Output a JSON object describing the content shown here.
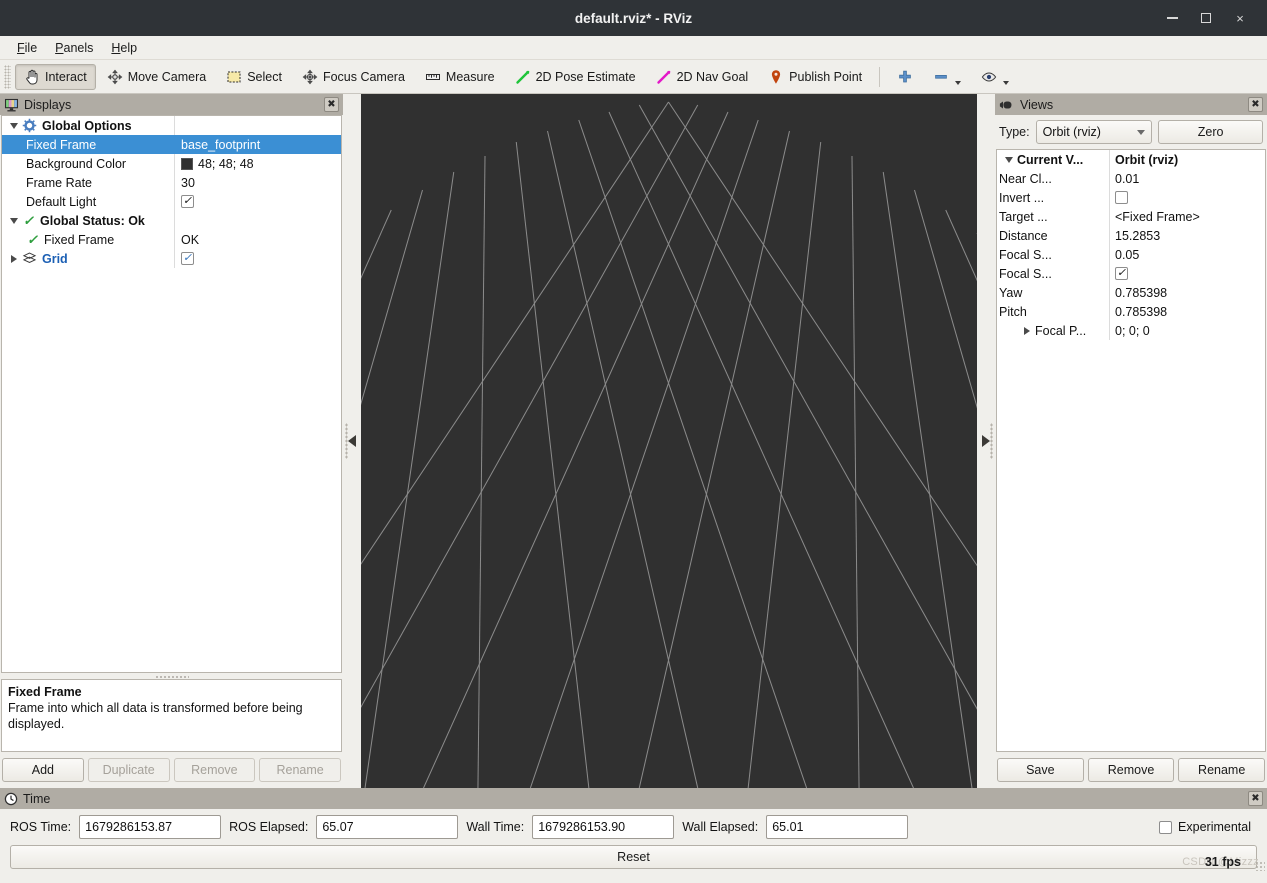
{
  "window": {
    "title": "default.rviz* - RViz",
    "controls": {
      "minimize": "minimize-icon",
      "maximize": "maximize-icon",
      "close": "×"
    }
  },
  "menubar": {
    "items": [
      "File",
      "Panels",
      "Help"
    ]
  },
  "toolbar": {
    "items": [
      {
        "label": "Interact",
        "icon": "hand-cursor-icon",
        "checked": true
      },
      {
        "label": "Move Camera",
        "icon": "move-camera-icon",
        "checked": false
      },
      {
        "label": "Select",
        "icon": "select-rect-icon",
        "checked": false
      },
      {
        "label": "Focus Camera",
        "icon": "focus-camera-icon",
        "checked": false
      },
      {
        "label": "Measure",
        "icon": "ruler-icon",
        "checked": false
      },
      {
        "label": "2D Pose Estimate",
        "icon": "pose-estimate-arrow-icon",
        "checked": false
      },
      {
        "label": "2D Nav Goal",
        "icon": "nav-goal-arrow-icon",
        "checked": false
      },
      {
        "label": "Publish Point",
        "icon": "map-pin-icon",
        "checked": false
      }
    ],
    "extras": [
      {
        "name": "zoom-in-icon",
        "glyph": "+"
      },
      {
        "name": "zoom-out-icon",
        "glyph": "−"
      },
      {
        "name": "eye-icon",
        "glyph": "eye"
      }
    ]
  },
  "displays": {
    "title": "Displays",
    "title_icon": "monitor-icon",
    "close_glyph": "✖",
    "rows": [
      {
        "name": "Global Options",
        "value": "",
        "indent": 0,
        "expander": "down",
        "icon": "gear-icon",
        "bold": true,
        "selected": false,
        "value_type": "none"
      },
      {
        "name": "Fixed Frame",
        "value": "base_footprint",
        "indent": 1,
        "expander": "none",
        "icon": "none",
        "bold": false,
        "selected": true,
        "value_type": "text"
      },
      {
        "name": "Background Color",
        "value": "48; 48; 48",
        "indent": 1,
        "expander": "none",
        "icon": "none",
        "bold": false,
        "selected": false,
        "value_type": "color",
        "swatch": "#303030"
      },
      {
        "name": "Frame Rate",
        "value": "30",
        "indent": 1,
        "expander": "none",
        "icon": "none",
        "bold": false,
        "selected": false,
        "value_type": "text"
      },
      {
        "name": "Default Light",
        "value": "checked",
        "indent": 1,
        "expander": "none",
        "icon": "none",
        "bold": false,
        "selected": false,
        "value_type": "checkbox"
      },
      {
        "name": "Global Status: Ok",
        "value": "",
        "indent": 0,
        "expander": "down",
        "icon": "green-check",
        "bold": true,
        "selected": false,
        "value_type": "none"
      },
      {
        "name": "Fixed Frame",
        "value": "OK",
        "indent": 1,
        "expander": "none",
        "icon": "green-check",
        "bold": false,
        "selected": false,
        "value_type": "text"
      },
      {
        "name": "Grid",
        "value": "checked",
        "indent": 0,
        "expander": "right",
        "icon": "grid-icon",
        "bold": true,
        "selected": false,
        "value_type": "checkbox",
        "blue": true
      }
    ],
    "help": {
      "heading": "Fixed Frame",
      "body": "Frame into which all data is transformed before being displayed."
    },
    "buttons": [
      {
        "label": "Add",
        "disabled": false
      },
      {
        "label": "Duplicate",
        "disabled": true
      },
      {
        "label": "Remove",
        "disabled": true
      },
      {
        "label": "Rename",
        "disabled": true
      }
    ]
  },
  "viewport": {
    "background_color": "#303030",
    "grid_color": "#9c9c9c",
    "grid_divisions": 10
  },
  "views": {
    "title": "Views",
    "title_icon": "camera-icon",
    "close_glyph": "✖",
    "type_label": "Type:",
    "type_value": "Orbit (rviz)",
    "zero_label": "Zero",
    "rows": [
      {
        "name": "Current V...",
        "value": "Orbit (rviz)",
        "indent": 0,
        "expander": "down",
        "bold": true,
        "value_type": "text"
      },
      {
        "name": "Near Cl...",
        "value": "0.01",
        "indent": 1,
        "expander": "none",
        "bold": false,
        "value_type": "text"
      },
      {
        "name": "Invert ...",
        "value": "unchecked",
        "indent": 1,
        "expander": "none",
        "bold": false,
        "value_type": "checkbox"
      },
      {
        "name": "Target ...",
        "value": "<Fixed Frame>",
        "indent": 1,
        "expander": "none",
        "bold": false,
        "value_type": "text"
      },
      {
        "name": "Distance",
        "value": "15.2853",
        "indent": 1,
        "expander": "none",
        "bold": false,
        "value_type": "text"
      },
      {
        "name": "Focal S...",
        "value": "0.05",
        "indent": 1,
        "expander": "none",
        "bold": false,
        "value_type": "text"
      },
      {
        "name": "Focal S...",
        "value": "checked",
        "indent": 1,
        "expander": "none",
        "bold": false,
        "value_type": "checkbox"
      },
      {
        "name": "Yaw",
        "value": "0.785398",
        "indent": 1,
        "expander": "none",
        "bold": false,
        "value_type": "text"
      },
      {
        "name": "Pitch",
        "value": "0.785398",
        "indent": 1,
        "expander": "none",
        "bold": false,
        "value_type": "text"
      },
      {
        "name": "Focal P...",
        "value": "0; 0; 0",
        "indent": 1,
        "expander": "right",
        "bold": false,
        "value_type": "text"
      }
    ],
    "buttons": [
      {
        "label": "Save",
        "disabled": false
      },
      {
        "label": "Remove",
        "disabled": false
      },
      {
        "label": "Rename",
        "disabled": false
      }
    ]
  },
  "time": {
    "title": "Time",
    "title_icon": "clock-icon",
    "close_glyph": "✖",
    "fields": [
      {
        "label": "ROS Time:",
        "value": "1679286153.87"
      },
      {
        "label": "ROS Elapsed:",
        "value": "65.07"
      },
      {
        "label": "Wall Time:",
        "value": "1679286153.90"
      },
      {
        "label": "Wall Elapsed:",
        "value": "65.01"
      }
    ],
    "experimental_label": "Experimental",
    "experimental_checked": false,
    "reset_label": "Reset",
    "fps": "31 fps",
    "watermark": "CSDN @Mizzz"
  }
}
